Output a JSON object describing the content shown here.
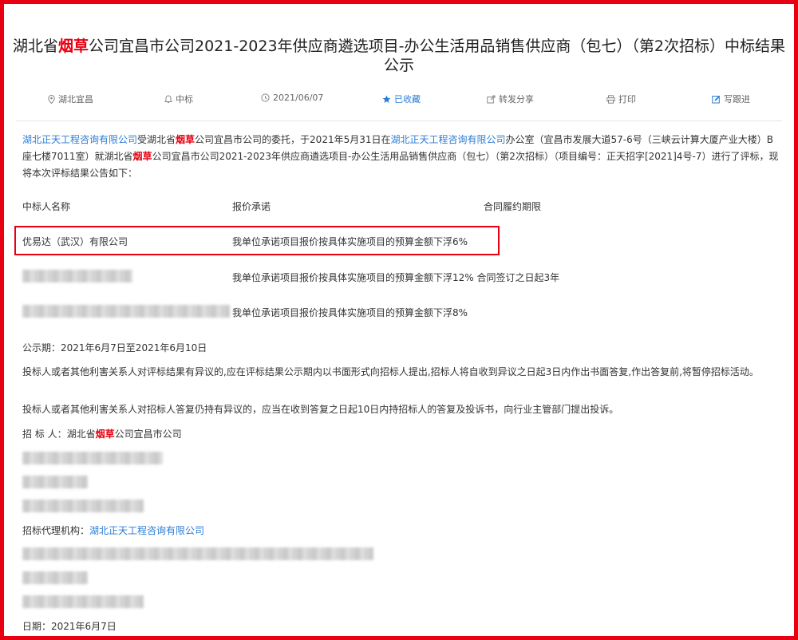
{
  "title": {
    "prefix": "湖北省",
    "highlight": "烟草",
    "suffix": "公司宜昌市公司2021-2023年供应商遴选项目-办公生活用品销售供应商（包七）（第2次招标）中标结果公示"
  },
  "toolbar": {
    "location": "湖北宜昌",
    "status": "中标",
    "date": "2021/06/07",
    "favorite": "已收藏",
    "share": "转发分享",
    "print": "打印",
    "follow": "写跟进"
  },
  "intro": {
    "agency1": "湖北正天工程咨询有限公司",
    "t1": "受湖北省",
    "hl1": "烟草",
    "t2": "公司宜昌市公司的委托，于2021年5月31日在",
    "agency2": "湖北正天工程咨询有限公司",
    "t3": "办公室（宜昌市发展大道57-6号（三峡云计算大厦产业大楼）B座七楼7011室）就湖北省",
    "hl2": "烟草",
    "t4": "公司宜昌市公司2021-2023年供应商遴选项目-办公生活用品销售供应商（包七）（第2次招标）（项目编号：正天招字[2021]4号-7）进行了评标，现将本次评标结果公告如下："
  },
  "table": {
    "headers": [
      "中标人名称",
      "报价承诺",
      "合同履约期限"
    ],
    "rows": [
      {
        "name": "优易达（武汉）有限公司",
        "quote": "我单位承诺项目报价按具体实施项目的预算金额下浮6%",
        "term": ""
      },
      {
        "name": "",
        "quote": "我单位承诺项目报价按具体实施项目的预算金额下浮12% 合同签订之日起3年",
        "term": ""
      },
      {
        "name": "",
        "quote": "我单位承诺项目报价按具体实施项目的预算金额下浮8%",
        "term": ""
      }
    ]
  },
  "notice": {
    "period": "公示期：2021年6月7日至2021年6月10日",
    "objection1": "投标人或者其他利害关系人对评标结果有异议的,应在评标结果公示期内以书面形式向招标人提出,招标人将自收到异议之日起3日内作出书面答复,作出答复前,将暂停招标活动。",
    "objection2": "投标人或者其他利害关系人对招标人答复仍持有异议的，应当在收到答复之日起10日内持招标人的答复及投诉书，向行业主管部门提出投诉。"
  },
  "tenderer": {
    "label": "招 标 人：湖北省",
    "highlight": "烟草",
    "suffix": "公司宜昌市公司"
  },
  "agency": {
    "label": "招标代理机构：",
    "name": "湖北正天工程咨询有限公司"
  },
  "footer_date": "日期：2021年6月7日",
  "colors": {
    "accent": "#e60012",
    "link": "#2b7cd3"
  }
}
